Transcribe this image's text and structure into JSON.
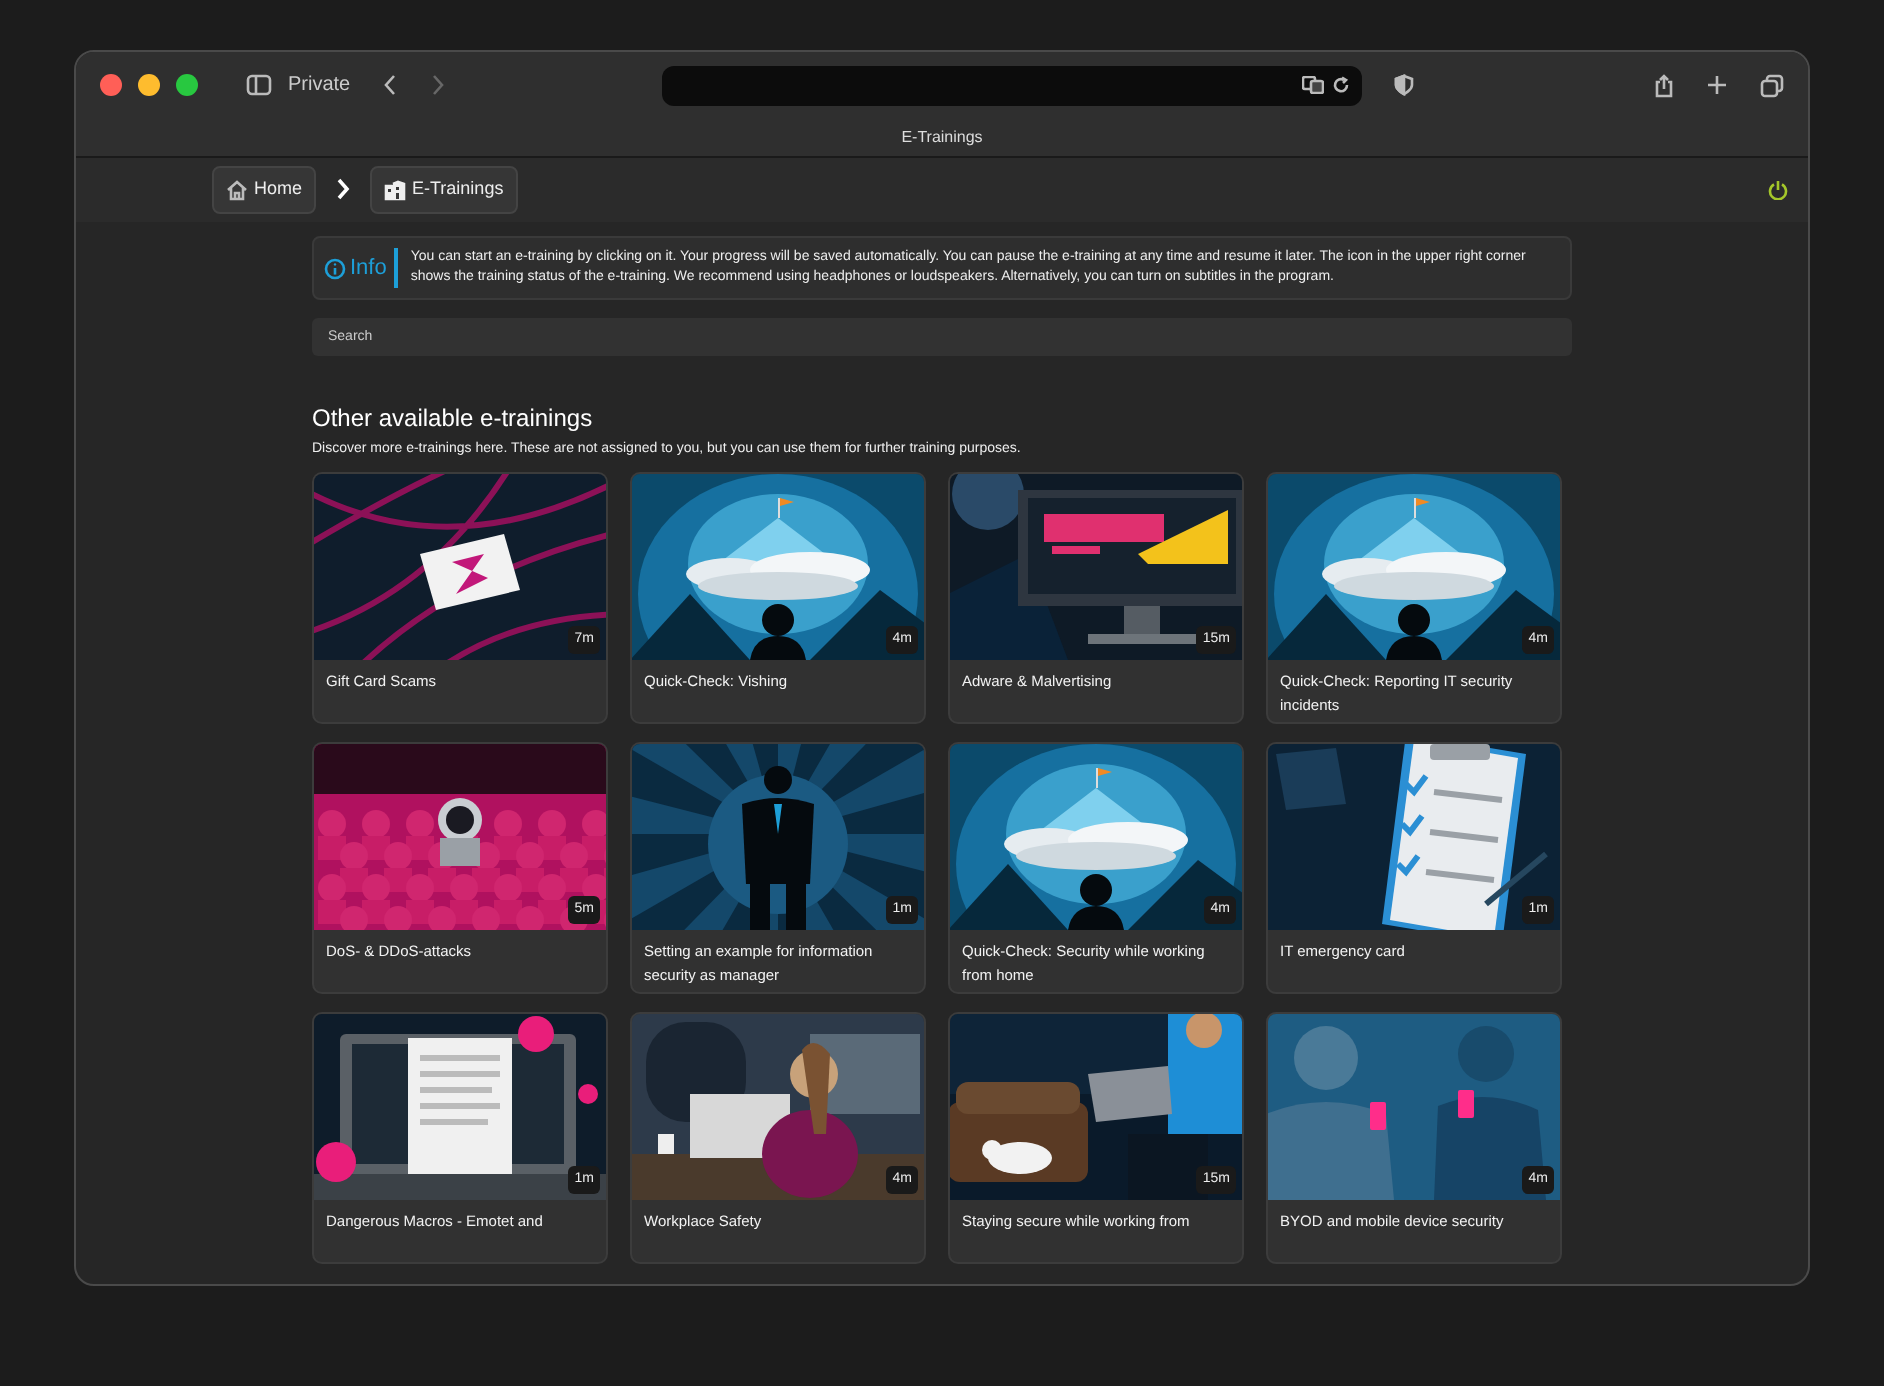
{
  "browser": {
    "mode": "Private",
    "tab_title": "E-Trainings",
    "forward_disabled": true
  },
  "breadcrumb": [
    {
      "label": "Home"
    },
    {
      "label": "E-Trainings"
    }
  ],
  "info": {
    "title": "Info",
    "text": "You can start an e-training by clicking on it. Your progress will be saved automatically. You can pause the e-training at any time and resume it later. The icon in the upper right corner shows the training status of the e-training. We recommend using headphones or loudspeakers. Alternatively, you can turn on subtitles in the program."
  },
  "search": {
    "placeholder": "Search"
  },
  "section": {
    "title": "Other available e-trainings",
    "subtitle": "Discover more e-trainings here. These are not assigned to you, but you can use them for further training purposes."
  },
  "trainings": [
    {
      "title": "Gift Card Scams",
      "duration": "7m"
    },
    {
      "title": "Quick-Check: Vishing",
      "duration": "4m"
    },
    {
      "title": "Adware & Malvertising",
      "duration": "15m"
    },
    {
      "title": "Quick-Check: Reporting IT security incidents",
      "duration": "4m"
    },
    {
      "title": "DoS- & DDoS-attacks",
      "duration": "5m"
    },
    {
      "title": "Setting an example for information security as manager",
      "duration": "1m"
    },
    {
      "title": "Quick-Check: Security while working from home",
      "duration": "4m"
    },
    {
      "title": "IT emergency card",
      "duration": "1m"
    },
    {
      "title": "Dangerous Macros - Emotet and",
      "duration": "1m"
    },
    {
      "title": "Workplace Safety",
      "duration": "4m"
    },
    {
      "title": "Staying secure while working from",
      "duration": "15m"
    },
    {
      "title": "BYOD and mobile device security",
      "duration": "4m"
    }
  ]
}
